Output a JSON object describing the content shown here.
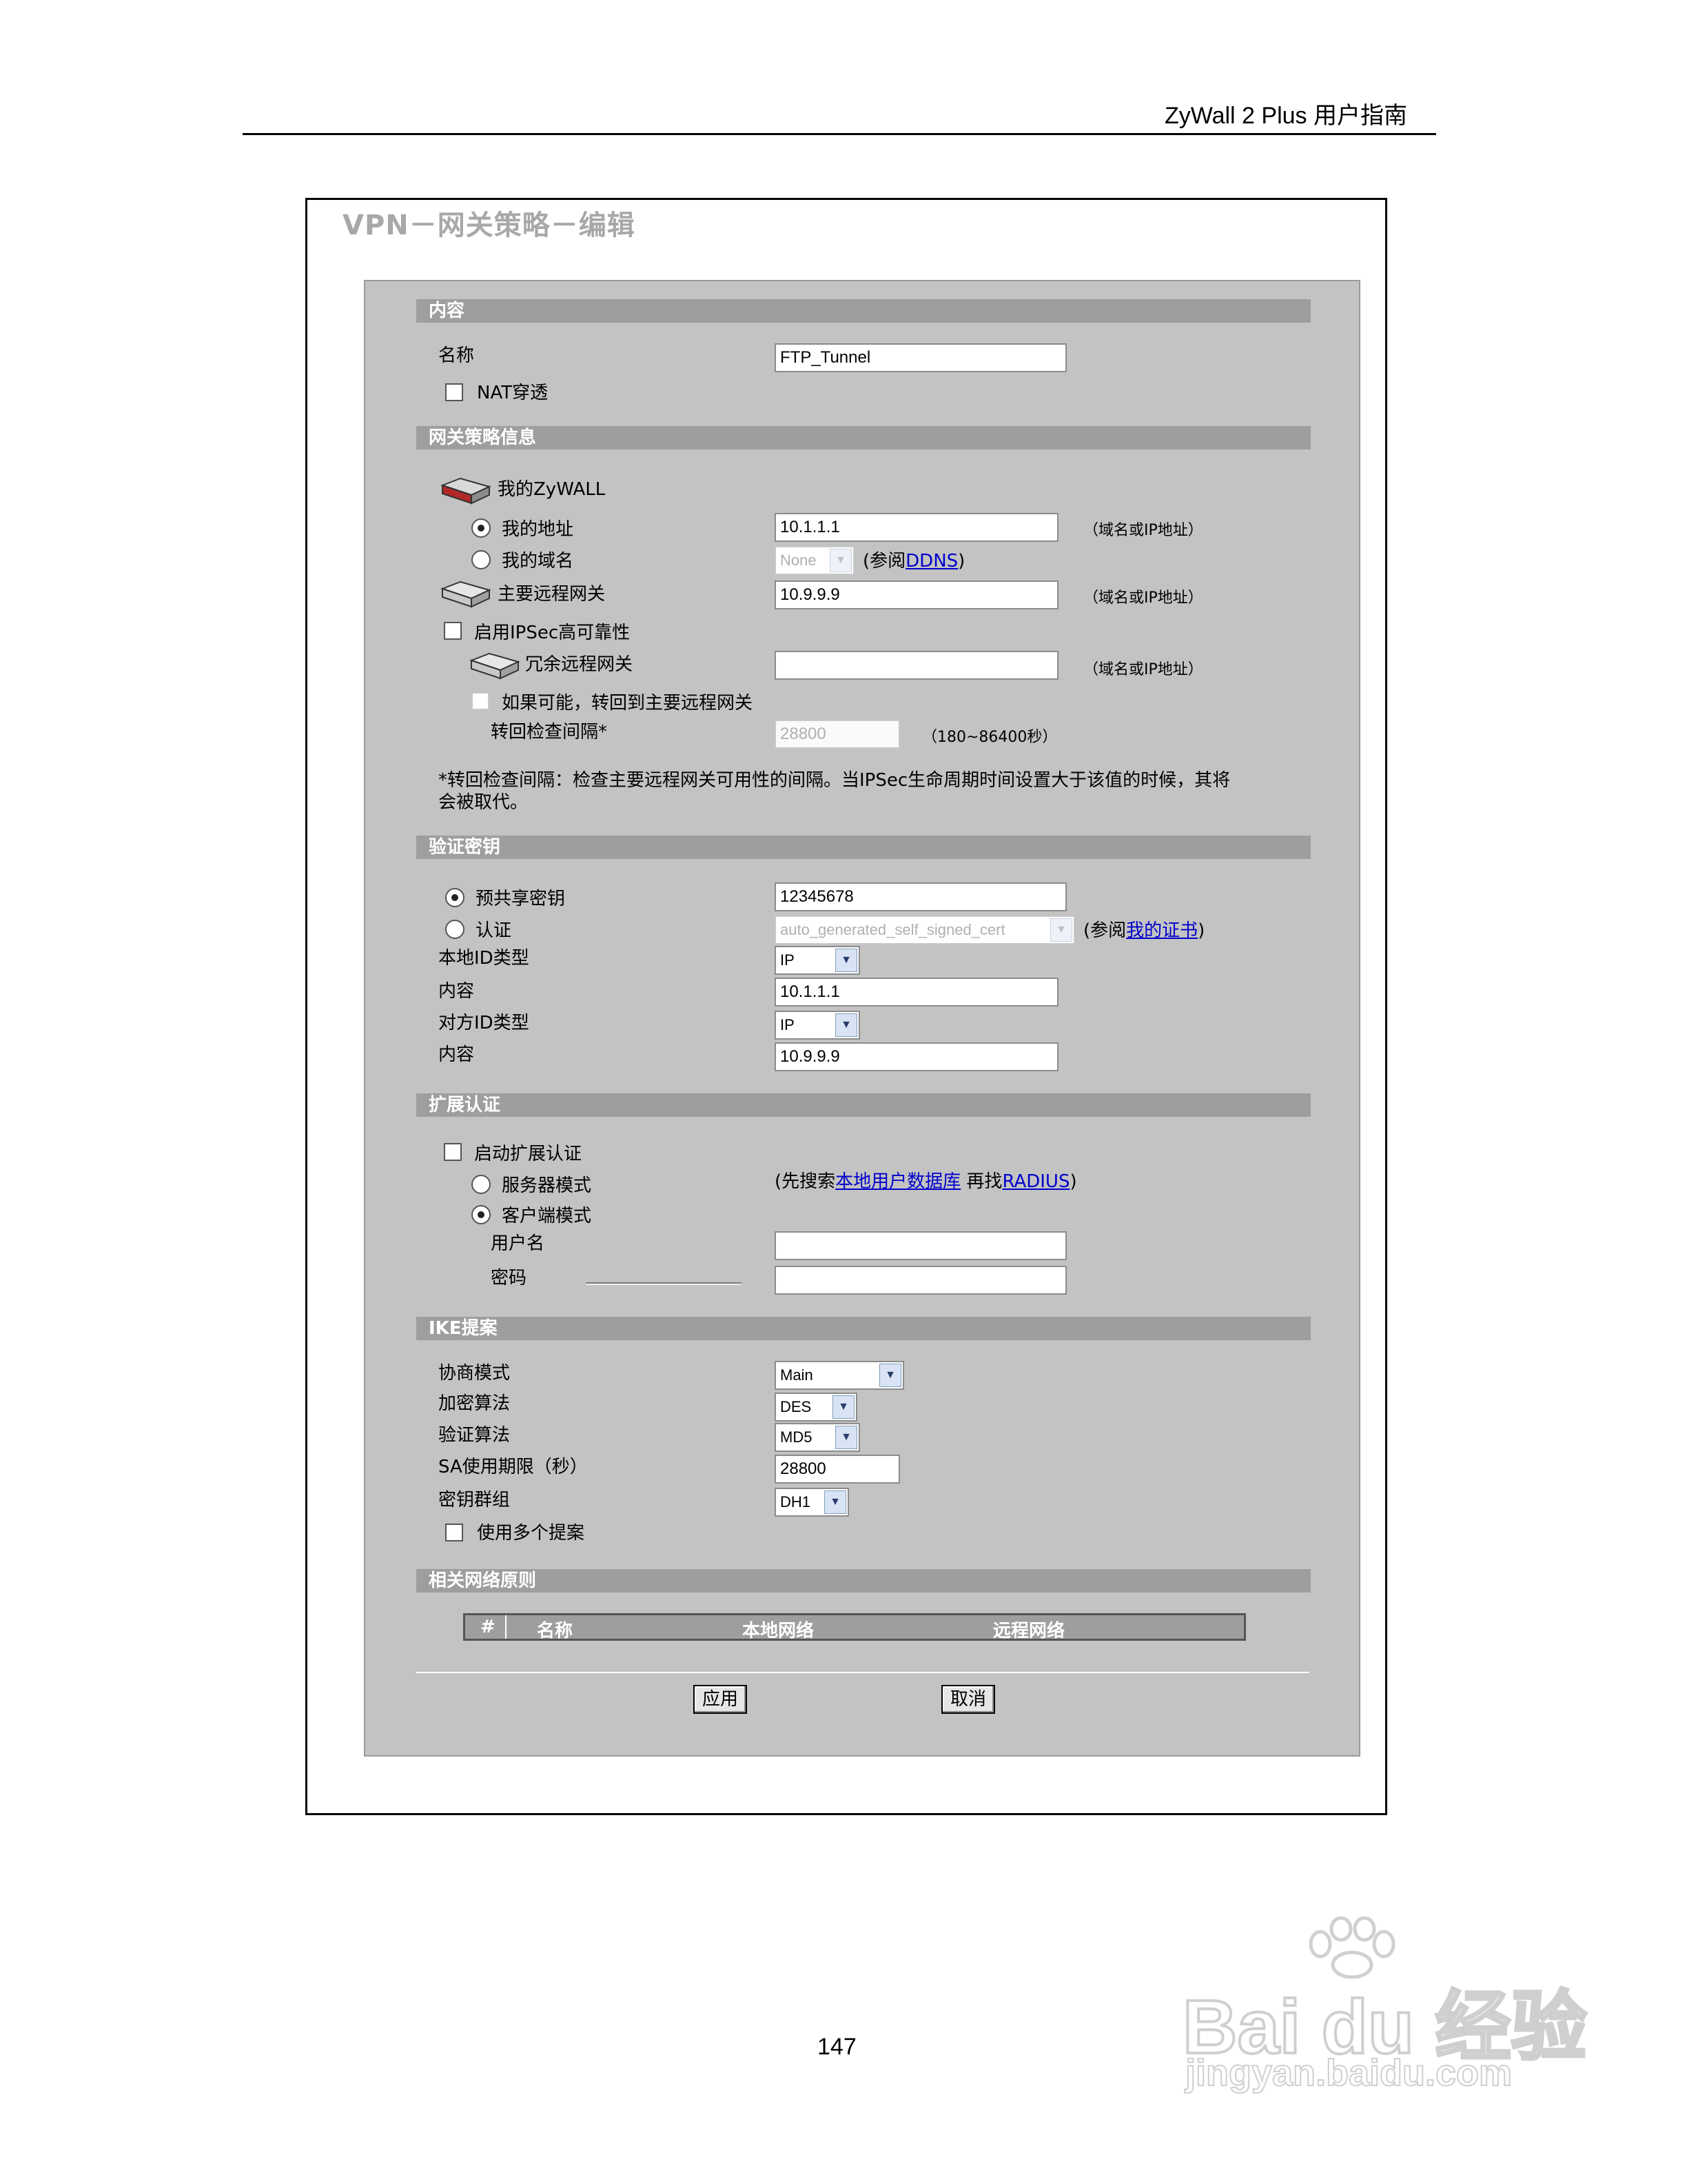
{
  "doc_header": "ZyWall 2 Plus  用户指南",
  "page_title": "VPN－网关策略－编辑",
  "page_number": "147",
  "sections": {
    "content": "内容",
    "gateway_info": "网关策略信息",
    "auth_key": "验证密钥",
    "extended_auth": "扩展认证",
    "ike": "IKE提案",
    "network_policy": "相关网络原则"
  },
  "content": {
    "name_label": "名称",
    "name_value": "FTP_Tunnel",
    "nat_label": "NAT穿透"
  },
  "gateway": {
    "my_zywall": "我的ZyWALL",
    "my_address_label": "我的地址",
    "my_address_value": "10.1.1.1",
    "hint": "（域名或IP地址）",
    "my_domain_label": "我的域名",
    "my_domain_value": "None",
    "ddns_pre": "(参阅",
    "ddns_link": "DDNS",
    "ddns_post": ")",
    "primary_remote_label": "主要远程网关",
    "primary_remote_value": "10.9.9.9",
    "ipsec_ha_label": "启用IPSec高可靠性",
    "redundant_label": "冗余远程网关",
    "redundant_value": "",
    "fallback_label": "如果可能，转回到主要远程网关",
    "interval_label": "转回检查间隔*",
    "interval_value": "28800",
    "interval_hint": "（180~86400秒）",
    "note_line1": "*转回检查间隔：检查主要远程网关可用性的间隔。当IPSec生命周期时间设置大于该值的时候，其将",
    "note_line2": "会被取代。"
  },
  "auth": {
    "psk_label": "预共享密钥",
    "psk_value": "12345678",
    "cert_label": "认证",
    "cert_value": "auto_generated_self_signed_cert",
    "cert_pre": "(参阅",
    "cert_link": "我的证书",
    "cert_post": ")",
    "local_id_type_label": "本地ID类型",
    "local_id_type_value": "IP",
    "local_content_label": "内容",
    "local_content_value": "10.1.1.1",
    "peer_id_type_label": "对方ID类型",
    "peer_id_type_value": "IP",
    "peer_content_label": "内容",
    "peer_content_value": "10.9.9.9"
  },
  "xauth": {
    "enable_label": "启动扩展认证",
    "server_mode_label": "服务器模式",
    "client_mode_label": "客户端模式",
    "search_pre": "(先搜索",
    "local_db_link": "本地用户数据库",
    "search_mid": " 再找",
    "radius_link": "RADIUS",
    "search_post": ")",
    "username_label": "用户名",
    "username_value": "",
    "password_label": "密码",
    "password_value": ""
  },
  "ike": {
    "negotiation_label": "协商模式",
    "negotiation_value": "Main",
    "encryption_label": "加密算法",
    "encryption_value": "DES",
    "auth_alg_label": "验证算法",
    "auth_alg_value": "MD5",
    "sa_life_label": "SA使用期限（秒）",
    "sa_life_value": "28800",
    "key_group_label": "密钥群组",
    "key_group_value": "DH1",
    "multi_proposal_label": "使用多个提案"
  },
  "table": {
    "columns": [
      "#",
      "名称",
      "本地网络",
      "远程网络"
    ]
  },
  "buttons": {
    "apply": "应用",
    "cancel": "取消"
  },
  "watermark": {
    "brand": "Bai du 经验",
    "url": "jingyan.baidu.com"
  },
  "colors": {
    "panel_bg": "#c3c3c3",
    "section_bar": "#9e9e9e",
    "link": "#0000cc"
  }
}
